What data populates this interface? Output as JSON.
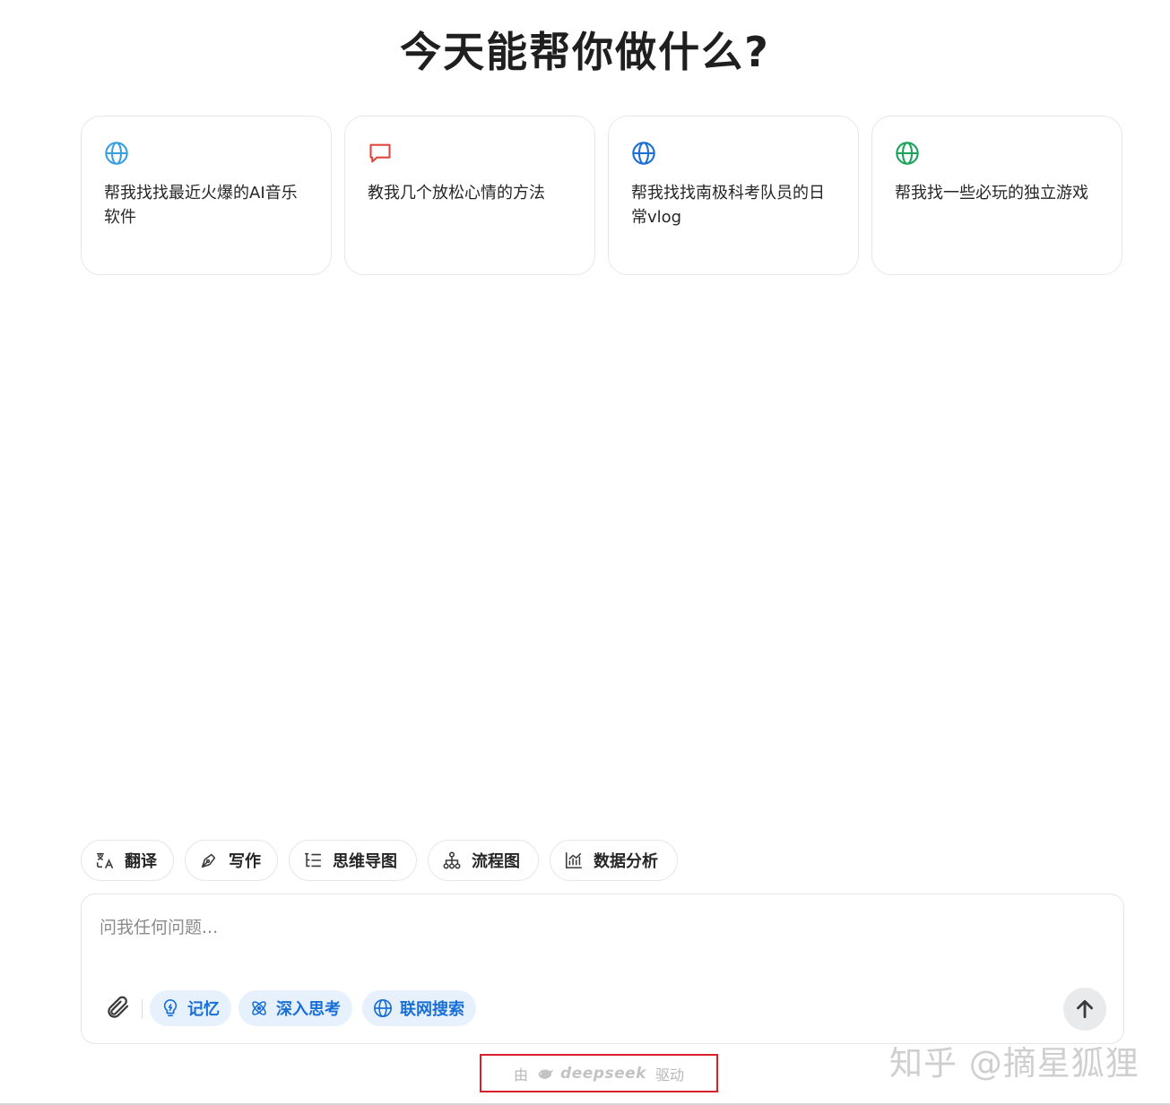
{
  "page": {
    "title": "今天能帮你做什么?"
  },
  "suggestions": [
    {
      "icon": "globe-icon",
      "color": "#3a9fe0",
      "text": "帮我找找最近火爆的AI音乐软件"
    },
    {
      "icon": "chat-bubble-icon",
      "color": "#e0483f",
      "text": "教我几个放松心情的方法"
    },
    {
      "icon": "globe-icon",
      "color": "#1a6fd6",
      "text": "帮我找找南极科考队员的日常vlog"
    },
    {
      "icon": "globe-icon",
      "color": "#1aa35a",
      "text": "帮我找一些必玩的独立游戏"
    }
  ],
  "tools": [
    {
      "icon": "translate-icon",
      "label": "翻译"
    },
    {
      "icon": "pen-icon",
      "label": "写作"
    },
    {
      "icon": "mindmap-icon",
      "label": "思维导图"
    },
    {
      "icon": "flowchart-icon",
      "label": "流程图"
    },
    {
      "icon": "chart-icon",
      "label": "数据分析"
    }
  ],
  "composer": {
    "placeholder": "问我任何问题...",
    "value": "",
    "options": [
      {
        "icon": "bulb-icon",
        "label": "记忆"
      },
      {
        "icon": "atom-icon",
        "label": "深入思考"
      },
      {
        "icon": "globe-icon",
        "label": "联网搜索"
      }
    ],
    "accent": "#1a6fd6",
    "pill_bg": "#e6f1fd"
  },
  "footer": {
    "prefix": "由",
    "brand": "deepseek",
    "suffix": "驱动"
  },
  "watermark": "知乎 @摘星狐狸"
}
